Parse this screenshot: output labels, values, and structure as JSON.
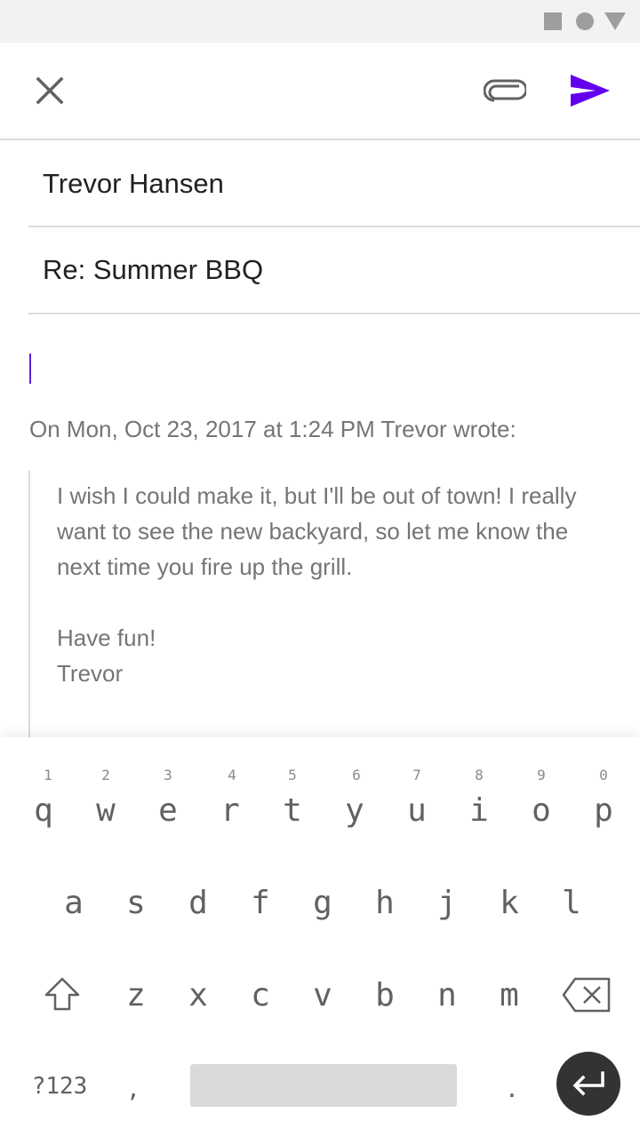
{
  "compose": {
    "to": "Trevor Hansen",
    "subject": "Re: Summer BBQ"
  },
  "quoted": {
    "header": "On Mon, Oct 23, 2017 at 1:24 PM Trevor wrote:",
    "body": "I wish I could make it, but I'll be out of town! I really want to see the new backyard, so let me know the next time you fire up the grill.",
    "signoff": "Have fun!",
    "signature": "Trevor"
  },
  "icons": {
    "close": "close-icon",
    "attach": "paperclip-icon",
    "send": "send-icon",
    "shift": "shift-icon",
    "backspace": "backspace-icon",
    "enter": "enter-icon"
  },
  "colors": {
    "accent": "#6200ee",
    "text": "#212121",
    "muted": "#757575"
  },
  "keyboard": {
    "row1_hints": [
      "1",
      "2",
      "3",
      "4",
      "5",
      "6",
      "7",
      "8",
      "9",
      "0"
    ],
    "row1": [
      "q",
      "w",
      "e",
      "r",
      "t",
      "y",
      "u",
      "i",
      "o",
      "p"
    ],
    "row2": [
      "a",
      "s",
      "d",
      "f",
      "g",
      "h",
      "j",
      "k",
      "l"
    ],
    "row3": [
      "z",
      "x",
      "c",
      "v",
      "b",
      "n",
      "m"
    ],
    "symbols_key": "?123",
    "comma_key": ",",
    "period_key": "."
  }
}
